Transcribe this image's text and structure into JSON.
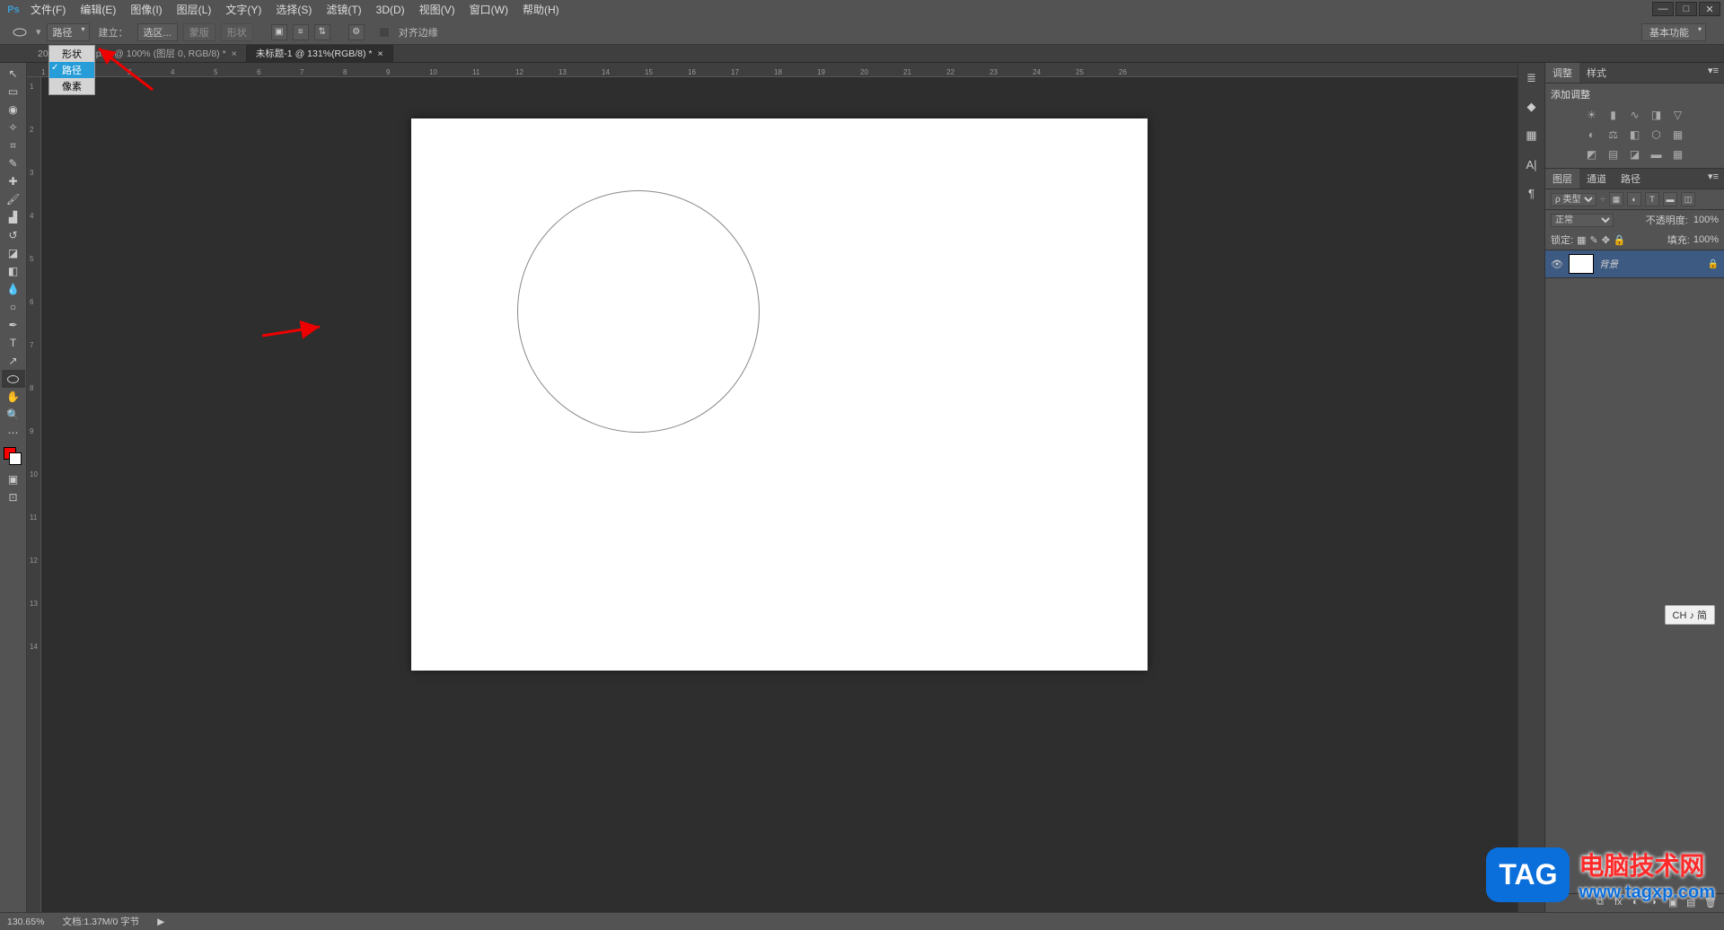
{
  "menubar": {
    "items": [
      "文件(F)",
      "编辑(E)",
      "图像(I)",
      "图层(L)",
      "文字(Y)",
      "选择(S)",
      "滤镜(T)",
      "3D(D)",
      "视图(V)",
      "窗口(W)",
      "帮助(H)"
    ]
  },
  "options": {
    "mode_label": "路径",
    "build_label": "建立：",
    "btn_selection": "选区...",
    "btn_mask": "蒙版",
    "btn_shape": "形状",
    "align_edges": "对齐边缘",
    "workspace": "基本功能"
  },
  "dropdown": {
    "items": [
      "形状",
      "路径",
      "像素"
    ],
    "selected_index": 1
  },
  "tabs": [
    {
      "label": "20...44...副本.png @ 100% (图层 0, RGB/8) *",
      "active": false
    },
    {
      "label": "未标题-1 @ 131%(RGB/8) *",
      "active": true
    }
  ],
  "ruler_h": [
    "1",
    "2",
    "3",
    "4",
    "5",
    "6",
    "7",
    "8",
    "9",
    "10",
    "11",
    "12",
    "13",
    "14",
    "15",
    "16",
    "17",
    "18",
    "19",
    "20",
    "21",
    "22",
    "23",
    "24",
    "25",
    "26"
  ],
  "ruler_v": [
    "1",
    "2",
    "3",
    "4",
    "5",
    "6",
    "7",
    "8",
    "9",
    "10",
    "11",
    "12",
    "13",
    "14"
  ],
  "panels": {
    "adjust_tab": "调整",
    "style_tab": "样式",
    "add_adjust_label": "添加调整",
    "layers_tab": "图层",
    "channels_tab": "通道",
    "paths_tab": "路径",
    "kind_label": "ρ 类型",
    "blend_normal": "正常",
    "opacity_label": "不透明度:",
    "opacity_val": "100%",
    "lock_label": "锁定:",
    "fill_label": "填充:",
    "fill_val": "100%",
    "layer_name": "背景"
  },
  "status": {
    "zoom": "130.65%",
    "doc": "文档:1.37M/0 字节"
  },
  "ime": "CH ♪ 简",
  "watermark": {
    "tag": "TAG",
    "cn": "电脑技术网",
    "url": "www.tagxp.com"
  }
}
